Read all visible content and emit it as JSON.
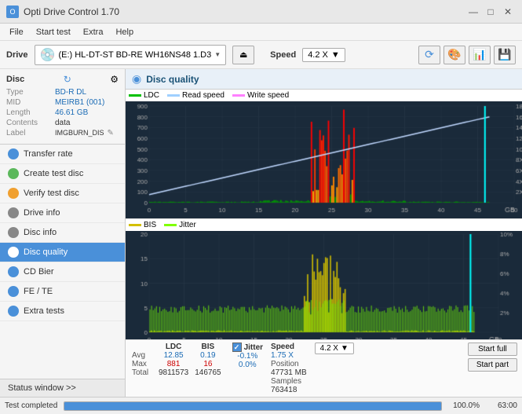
{
  "titleBar": {
    "title": "Opti Drive Control 1.70",
    "minimize": "—",
    "maximize": "□",
    "close": "✕"
  },
  "menuBar": {
    "items": [
      "File",
      "Start test",
      "Extra",
      "Help"
    ]
  },
  "driveBar": {
    "label": "Drive",
    "driveText": "(E:)  HL-DT-ST BD-RE  WH16NS48 1.D3",
    "speedLabel": "Speed",
    "speedValue": "4.2 X"
  },
  "sidebar": {
    "discLabel": "Disc",
    "discFields": [
      {
        "field": "Type",
        "value": "BD-R DL"
      },
      {
        "field": "MID",
        "value": "MEIRB1 (001)"
      },
      {
        "field": "Length",
        "value": "46.61 GB"
      },
      {
        "field": "Contents",
        "value": "data"
      },
      {
        "field": "Label",
        "value": "IMGBURN_DIS"
      }
    ],
    "navItems": [
      {
        "label": "Transfer rate",
        "active": false
      },
      {
        "label": "Create test disc",
        "active": false
      },
      {
        "label": "Verify test disc",
        "active": false
      },
      {
        "label": "Drive info",
        "active": false
      },
      {
        "label": "Disc info",
        "active": false
      },
      {
        "label": "Disc quality",
        "active": true
      },
      {
        "label": "CD Bier",
        "active": false
      },
      {
        "label": "FE / TE",
        "active": false
      },
      {
        "label": "Extra tests",
        "active": false
      }
    ],
    "statusWindow": "Status window >>"
  },
  "content": {
    "title": "Disc quality",
    "legend": {
      "ldc": "LDC",
      "readSpeed": "Read speed",
      "writeSpeed": "Write speed",
      "bis": "BIS",
      "jitter": "Jitter"
    }
  },
  "stats": {
    "columns": [
      "LDC",
      "BIS",
      "",
      "Jitter",
      "Speed",
      ""
    ],
    "avgRow": [
      "12.85",
      "0.19",
      "",
      "-0.1%",
      "1.75 X",
      "4.2 X"
    ],
    "maxRow": [
      "881",
      "16",
      "",
      "0.0%",
      "Position",
      "47731 MB"
    ],
    "totalRow": [
      "9811573",
      "146765",
      "",
      "",
      "Samples",
      "763418"
    ],
    "avgLabel": "Avg",
    "maxLabel": "Max",
    "totalLabel": "Total",
    "jitterLabel": "Jitter",
    "speedLabel": "Speed",
    "positionLabel": "Position",
    "samplesLabel": "Samples",
    "speedVal": "1.75 X",
    "speedDisplay": "4.2 X",
    "positionVal": "47731 MB",
    "samplesVal": "763418",
    "startFull": "Start full",
    "startPart": "Start part"
  },
  "statusBar": {
    "text": "Test completed",
    "progress": 100,
    "progressText": "100.0%",
    "time": "63:00"
  },
  "colors": {
    "ldc": "#00c000",
    "readSpeed": "#a0d0ff",
    "writeSpeed": "#ff80ff",
    "bis": "#d4c000",
    "jitter": "#80ff00",
    "accent": "#4a90d9"
  }
}
